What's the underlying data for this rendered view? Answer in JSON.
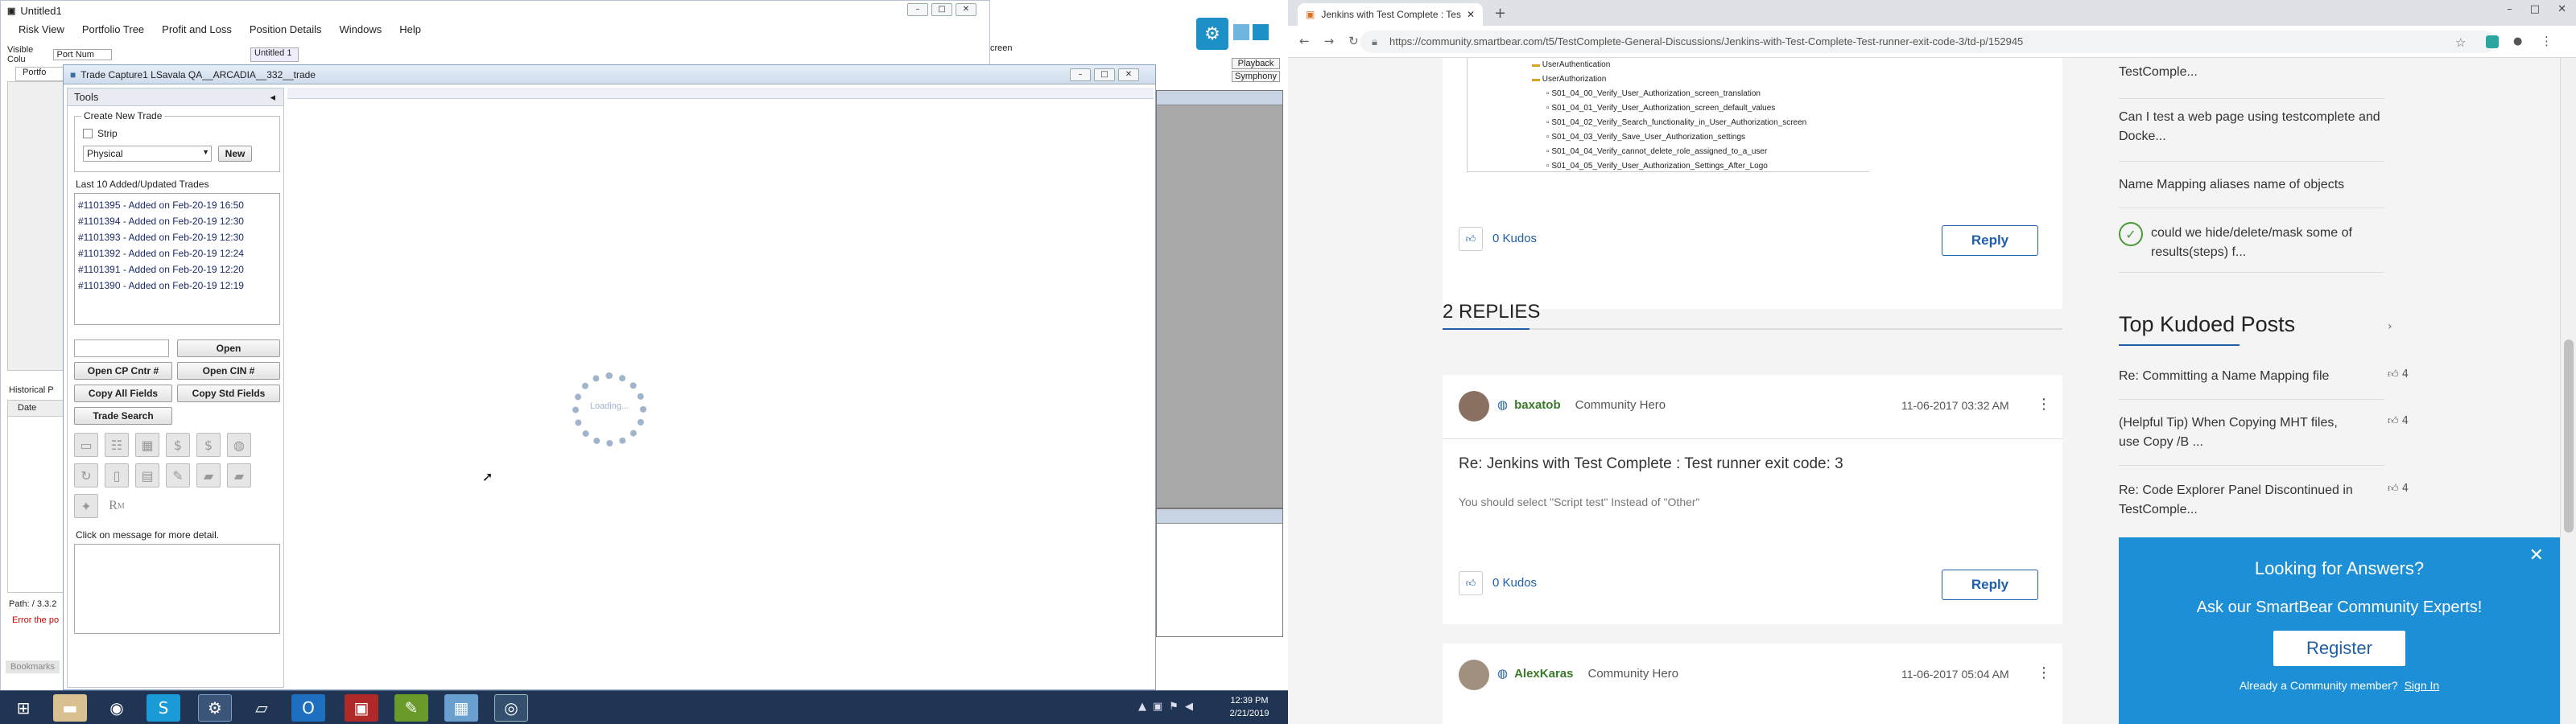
{
  "left": {
    "main_title": "Untitled1",
    "menu": [
      "Risk View",
      "Portfolio Tree",
      "Profit and Loss",
      "Position Details",
      "Windows",
      "Help"
    ],
    "visible_cols_label": "Visible Colu",
    "port_num": "Port Num",
    "untitled_tab": "Untitled 1",
    "portfo_tab": "Portfo",
    "screen_label": "creen",
    "playback": "Playback",
    "symphony": "Symphony",
    "historical_tab": "Historical P",
    "date_col": "Date",
    "path_label": "Path: / 3.3.2",
    "error_text": "Error the po",
    "bookmarks": "Bookmarks",
    "trade_window": {
      "title": "Trade Capture1  LSavala  QA__ARCADIA__332__trade",
      "tools_label": "Tools",
      "create_group": "Create New Trade",
      "strip_label": "Strip",
      "type_value": "Physical",
      "new_button": "New",
      "last10_label": "Last 10 Added/Updated Trades",
      "trades": [
        "#1101395 - Added on Feb-20-19 16:50",
        "#1101394 - Added on Feb-20-19 12:30",
        "#1101393 - Added on Feb-20-19 12:30",
        "#1101392 - Added on Feb-20-19 12:24",
        "#1101391 - Added on Feb-20-19 12:20",
        "#1101390 - Added on Feb-20-19 12:19"
      ],
      "open_button": "Open",
      "open_cp_button": "Open CP Cntr #",
      "open_cin_button": "Open CIN #",
      "copy_all_button": "Copy All Fields",
      "copy_std_button": "Copy Std Fields",
      "trade_search_button": "Trade Search",
      "message_label": "Click on message for more detail.",
      "loading_text": "Loading..."
    },
    "clock_time": "12:39 PM",
    "clock_date": "2/21/2019"
  },
  "right": {
    "tab_title": "Jenkins with Test Complete : Tes",
    "url": "https://community.smartbear.com/t5/TestComplete-General-Discussions/Jenkins-with-Test-Complete-Test-runner-exit-code-3/td-p/152945",
    "tree": {
      "root": "UserAuthentication",
      "folder": "UserAuthorization",
      "items": [
        "S01_04_00_Verify_User_Authorization_screen_translation",
        "S01_04_01_Verify_User_Authorization_screen_default_values",
        "S01_04_02_Verify_Search_functionality_in_User_Authorization_screen",
        "S01_04_03_Verify_Save_User_Authorization_settings",
        "S01_04_04_Verify_cannot_delete_role_assigned_to_a_user",
        "S01_04_05_Verify_User_Authorization_Settings_After_Logo"
      ]
    },
    "kudos_label": "0 Kudos",
    "reply_label": "Reply",
    "replies_heading": "2 REPLIES",
    "reply1": {
      "author": "baxatob",
      "role": "Community Hero",
      "date": "11-06-2017 03:32 AM",
      "subject": "Re: Jenkins with Test Complete : Test runner exit code: 3",
      "body": "You should select \"Script test\" Instead of \"Other\""
    },
    "reply2": {
      "author": "AlexKaras",
      "role": "Community Hero",
      "date": "11-06-2017 05:04 AM"
    },
    "sidebar": {
      "top_item": "TestComple...",
      "links": [
        "Can I test a web page using testcomplete and Docke...",
        "Name Mapping aliases name of objects",
        "could we hide/delete/mask some of results(steps) f..."
      ],
      "top_kudoed_heading": "Top Kudoed Posts",
      "kudoed": [
        {
          "text": "Re: Committing a Name Mapping file",
          "count": "4"
        },
        {
          "text": "(Helpful Tip) When Copying MHT files, use Copy /B ...",
          "count": "4"
        },
        {
          "text": "Re: Code Explorer Panel Discontinued in TestComple...",
          "count": "4"
        }
      ]
    },
    "popup": {
      "heading": "Looking for Answers?",
      "subtext": "Ask our SmartBear Community Experts!",
      "register": "Register",
      "already": "Already a Community member?",
      "signin": "Sign In"
    }
  },
  "colors": {
    "taskbar": "#1f3553",
    "accent": "#1f5fa8",
    "popup": "#1d8fd6",
    "community_green": "#3a7a2a"
  }
}
